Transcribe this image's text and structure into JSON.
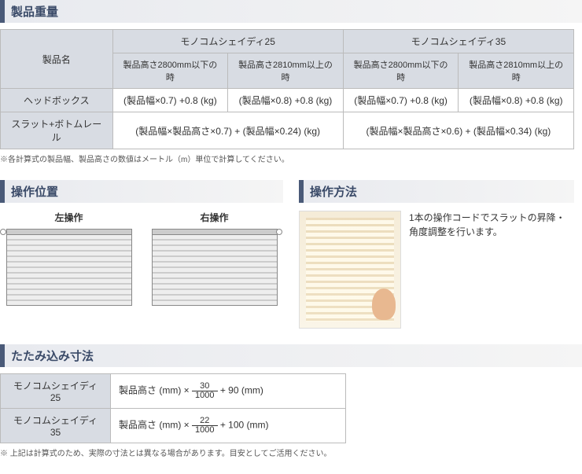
{
  "sections": {
    "weight_title": "製品重量",
    "position_title": "操作位置",
    "method_title": "操作方法",
    "fold_title": "たたみ込み寸法"
  },
  "weight_table": {
    "col_product": "製品名",
    "product_a": "モノコムシェイディ25",
    "product_b": "モノコムシェイディ35",
    "cond_low": "製品高さ2800mm以下の時",
    "cond_high": "製品高さ2810mm以上の時",
    "row_headbox": "ヘッドボックス",
    "row_slat": "スラット+ボトムレール",
    "hb_a_low": "(製品幅×0.7) +0.8 (kg)",
    "hb_a_high": "(製品幅×0.8) +0.8 (kg)",
    "hb_b_low": "(製品幅×0.7) +0.8 (kg)",
    "hb_b_high": "(製品幅×0.8) +0.8 (kg)",
    "slat_a": "(製品幅×製品高さ×0.7) + (製品幅×0.24) (kg)",
    "slat_b": "(製品幅×製品高さ×0.6) + (製品幅×0.34) (kg)",
    "note": "※各計算式の製品幅、製品高さの数値はメートル（m）単位で計算してください。"
  },
  "position": {
    "left_label": "左操作",
    "right_label": "右操作"
  },
  "method": {
    "text": "1本の操作コードでスラットの昇降・角度調整を行います。"
  },
  "fold_table": {
    "row_a_name": "モノコムシェイディ25",
    "row_b_name": "モノコムシェイディ35",
    "formula_prefix": "製品高さ (mm) ×",
    "a_num": "30",
    "a_den": "1000",
    "a_suffix": "+ 90 (mm)",
    "b_num": "22",
    "b_den": "1000",
    "b_suffix": "+ 100 (mm)",
    "note": "※ 上記は計算式のため、実際の寸法とは異なる場合があります。目安としてご活用ください。"
  }
}
